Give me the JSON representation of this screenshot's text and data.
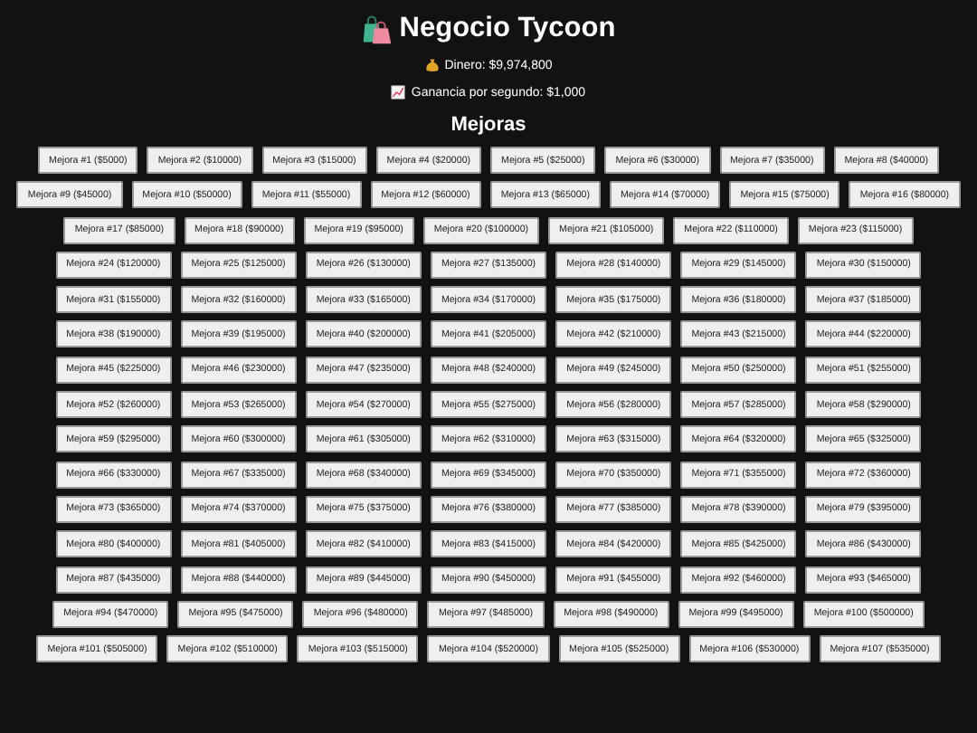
{
  "title": "Negocio Tycoon",
  "money": "Dinero: $9,974,800",
  "income": "Ganancia por segundo: $1,000",
  "upgrades_heading": "Mejoras",
  "upgrades": [
    "Mejora #1 ($5000)",
    "Mejora #2 ($10000)",
    "Mejora #3 ($15000)",
    "Mejora #4 ($20000)",
    "Mejora #5 ($25000)",
    "Mejora #6 ($30000)",
    "Mejora #7 ($35000)",
    "Mejora #8 ($40000)",
    "Mejora #9 ($45000)",
    "Mejora #10 ($50000)",
    "Mejora #11 ($55000)",
    "Mejora #12 ($60000)",
    "Mejora #13 ($65000)",
    "Mejora #14 ($70000)",
    "Mejora #15 ($75000)",
    "Mejora #16 ($80000)",
    "Mejora #17 ($85000)",
    "Mejora #18 ($90000)",
    "Mejora #19 ($95000)",
    "Mejora #20 ($100000)",
    "Mejora #21 ($105000)",
    "Mejora #22 ($110000)",
    "Mejora #23 ($115000)",
    "Mejora #24 ($120000)",
    "Mejora #25 ($125000)",
    "Mejora #26 ($130000)",
    "Mejora #27 ($135000)",
    "Mejora #28 ($140000)",
    "Mejora #29 ($145000)",
    "Mejora #30 ($150000)",
    "Mejora #31 ($155000)",
    "Mejora #32 ($160000)",
    "Mejora #33 ($165000)",
    "Mejora #34 ($170000)",
    "Mejora #35 ($175000)",
    "Mejora #36 ($180000)",
    "Mejora #37 ($185000)",
    "Mejora #38 ($190000)",
    "Mejora #39 ($195000)",
    "Mejora #40 ($200000)",
    "Mejora #41 ($205000)",
    "Mejora #42 ($210000)",
    "Mejora #43 ($215000)",
    "Mejora #44 ($220000)",
    "Mejora #45 ($225000)",
    "Mejora #46 ($230000)",
    "Mejora #47 ($235000)",
    "Mejora #48 ($240000)",
    "Mejora #49 ($245000)",
    "Mejora #50 ($250000)",
    "Mejora #51 ($255000)",
    "Mejora #52 ($260000)",
    "Mejora #53 ($265000)",
    "Mejora #54 ($270000)",
    "Mejora #55 ($275000)",
    "Mejora #56 ($280000)",
    "Mejora #57 ($285000)",
    "Mejora #58 ($290000)",
    "Mejora #59 ($295000)",
    "Mejora #60 ($300000)",
    "Mejora #61 ($305000)",
    "Mejora #62 ($310000)",
    "Mejora #63 ($315000)",
    "Mejora #64 ($320000)",
    "Mejora #65 ($325000)",
    "Mejora #66 ($330000)",
    "Mejora #67 ($335000)",
    "Mejora #68 ($340000)",
    "Mejora #69 ($345000)",
    "Mejora #70 ($350000)",
    "Mejora #71 ($355000)",
    "Mejora #72 ($360000)",
    "Mejora #73 ($365000)",
    "Mejora #74 ($370000)",
    "Mejora #75 ($375000)",
    "Mejora #76 ($380000)",
    "Mejora #77 ($385000)",
    "Mejora #78 ($390000)",
    "Mejora #79 ($395000)",
    "Mejora #80 ($400000)",
    "Mejora #81 ($405000)",
    "Mejora #82 ($410000)",
    "Mejora #83 ($415000)",
    "Mejora #84 ($420000)",
    "Mejora #85 ($425000)",
    "Mejora #86 ($430000)",
    "Mejora #87 ($435000)",
    "Mejora #88 ($440000)",
    "Mejora #89 ($445000)",
    "Mejora #90 ($450000)",
    "Mejora #91 ($455000)",
    "Mejora #92 ($460000)",
    "Mejora #93 ($465000)",
    "Mejora #94 ($470000)",
    "Mejora #95 ($475000)",
    "Mejora #96 ($480000)",
    "Mejora #97 ($485000)",
    "Mejora #98 ($490000)",
    "Mejora #99 ($495000)",
    "Mejora #100 ($500000)",
    "Mejora #101 ($505000)",
    "Mejora #102 ($510000)",
    "Mejora #103 ($515000)",
    "Mejora #104 ($520000)",
    "Mejora #105 ($525000)",
    "Mejora #106 ($530000)",
    "Mejora #107 ($535000)"
  ]
}
